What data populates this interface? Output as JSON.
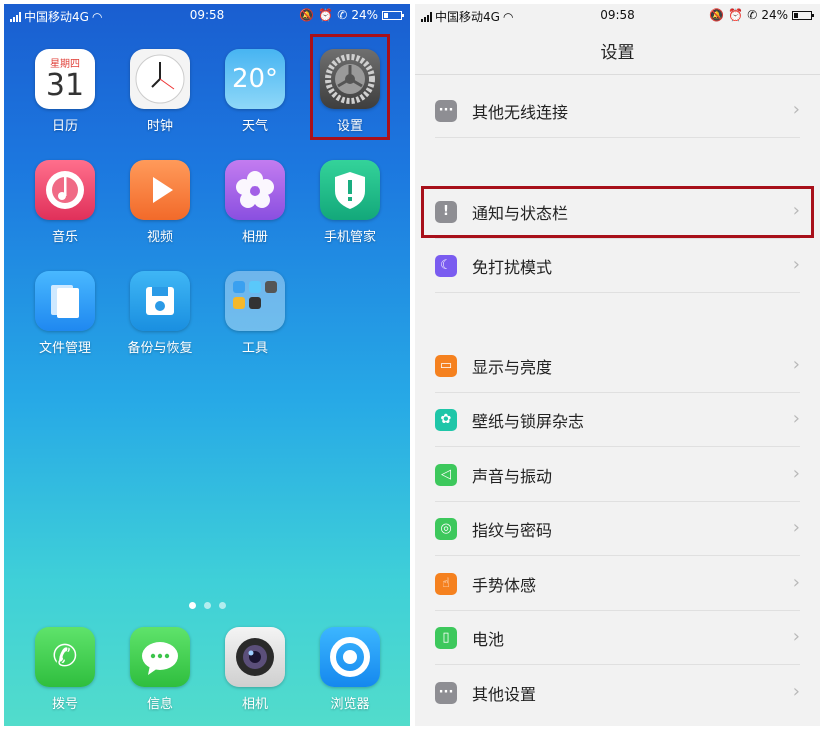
{
  "home": {
    "status": {
      "carrier": "中国移动4G",
      "time": "09:58",
      "battery": "24%"
    },
    "apps": [
      {
        "id": "calendar",
        "label": "日历",
        "weekday": "星期四",
        "day": "31"
      },
      {
        "id": "clock",
        "label": "时钟"
      },
      {
        "id": "weather",
        "label": "天气",
        "temp": "20°"
      },
      {
        "id": "settings",
        "label": "设置"
      },
      {
        "id": "music",
        "label": "音乐"
      },
      {
        "id": "video",
        "label": "视频"
      },
      {
        "id": "photos",
        "label": "相册"
      },
      {
        "id": "phone-manager",
        "label": "手机管家"
      },
      {
        "id": "file-manager",
        "label": "文件管理"
      },
      {
        "id": "backup",
        "label": "备份与恢复"
      },
      {
        "id": "tools",
        "label": "工具"
      }
    ],
    "dock": [
      {
        "id": "dialer",
        "label": "拨号"
      },
      {
        "id": "messages",
        "label": "信息"
      },
      {
        "id": "camera",
        "label": "相机"
      },
      {
        "id": "browser",
        "label": "浏览器"
      }
    ]
  },
  "settings": {
    "status": {
      "carrier": "中国移动4G",
      "time": "09:58",
      "battery": "24%"
    },
    "title": "设置",
    "items": [
      {
        "label": "其他无线连接",
        "icon": "more-icon",
        "color": "#8e8e93"
      },
      {
        "label": "通知与状态栏",
        "icon": "notification-icon",
        "color": "#8e8e93"
      },
      {
        "label": "免打扰模式",
        "icon": "moon-icon",
        "color": "#7a5cf0"
      },
      {
        "label": "显示与亮度",
        "icon": "display-icon",
        "color": "#f5811f"
      },
      {
        "label": "壁纸与锁屏杂志",
        "icon": "flower-icon",
        "color": "#1fc6a8"
      },
      {
        "label": "声音与振动",
        "icon": "speaker-icon",
        "color": "#3dc85c"
      },
      {
        "label": "指纹与密码",
        "icon": "fingerprint-icon",
        "color": "#3dc85c"
      },
      {
        "label": "手势体感",
        "icon": "hand-icon",
        "color": "#f5811f"
      },
      {
        "label": "电池",
        "icon": "battery-icon",
        "color": "#3dc85c"
      },
      {
        "label": "其他设置",
        "icon": "more-icon",
        "color": "#8e8e93"
      }
    ]
  },
  "highlight_color": "#a8101a"
}
